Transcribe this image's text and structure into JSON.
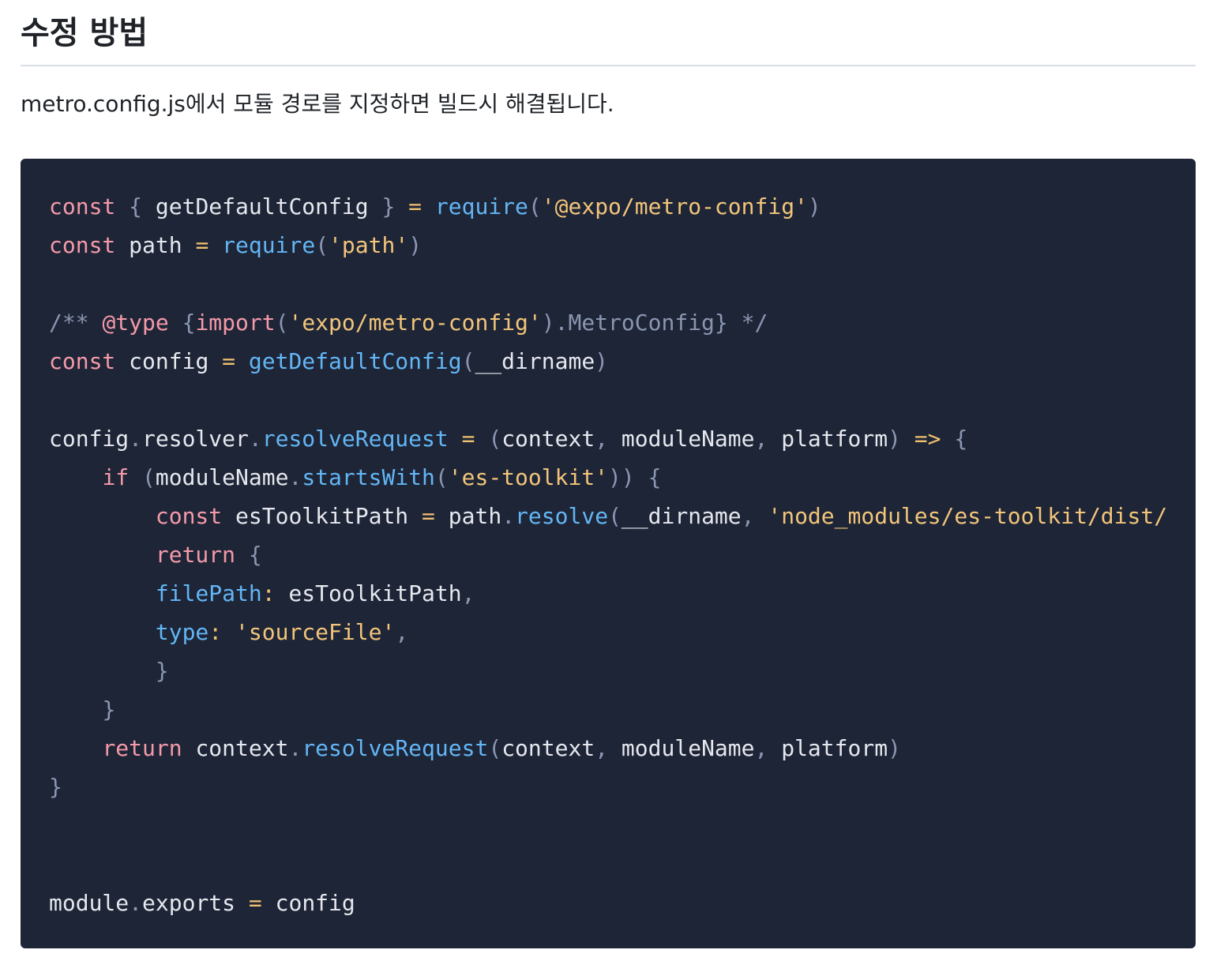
{
  "heading": "수정 방법",
  "paragraph": "metro.config.js에서 모듈 경로를 지정하면 빌드시 해결됩니다.",
  "code": {
    "language": "javascript",
    "lines": [
      [
        [
          "k",
          "const"
        ],
        [
          "id",
          " "
        ],
        [
          "p",
          "{"
        ],
        [
          "id",
          " getDefaultConfig "
        ],
        [
          "p",
          "}"
        ],
        [
          "id",
          " "
        ],
        [
          "o",
          "="
        ],
        [
          "id",
          " "
        ],
        [
          "f",
          "require"
        ],
        [
          "p",
          "("
        ],
        [
          "s",
          "'@expo/metro-config'"
        ],
        [
          "p",
          ")"
        ]
      ],
      [
        [
          "k",
          "const"
        ],
        [
          "id",
          " path "
        ],
        [
          "o",
          "="
        ],
        [
          "id",
          " "
        ],
        [
          "f",
          "require"
        ],
        [
          "p",
          "("
        ],
        [
          "s",
          "'path'"
        ],
        [
          "p",
          ")"
        ]
      ],
      [],
      [
        [
          "c",
          "/** "
        ],
        [
          "k",
          "@type"
        ],
        [
          "c",
          " "
        ],
        [
          "p",
          "{"
        ],
        [
          "k",
          "import"
        ],
        [
          "p",
          "("
        ],
        [
          "s",
          "'expo/metro-config'"
        ],
        [
          "p",
          ")."
        ],
        [
          "c",
          "MetroConfig"
        ],
        [
          "p",
          "}"
        ],
        [
          "c",
          " */"
        ]
      ],
      [
        [
          "k",
          "const"
        ],
        [
          "id",
          " config "
        ],
        [
          "o",
          "="
        ],
        [
          "id",
          " "
        ],
        [
          "f",
          "getDefaultConfig"
        ],
        [
          "p",
          "("
        ],
        [
          "id",
          "__dirname"
        ],
        [
          "p",
          ")"
        ]
      ],
      [],
      [
        [
          "id",
          "config"
        ],
        [
          "p",
          "."
        ],
        [
          "id",
          "resolver"
        ],
        [
          "p",
          "."
        ],
        [
          "f",
          "resolveRequest"
        ],
        [
          "id",
          " "
        ],
        [
          "o",
          "="
        ],
        [
          "id",
          " "
        ],
        [
          "p",
          "("
        ],
        [
          "id",
          "context"
        ],
        [
          "p",
          ","
        ],
        [
          "id",
          " moduleName"
        ],
        [
          "p",
          ","
        ],
        [
          "id",
          " platform"
        ],
        [
          "p",
          ")"
        ],
        [
          "id",
          " "
        ],
        [
          "o",
          "=>"
        ],
        [
          "id",
          " "
        ],
        [
          "p",
          "{"
        ]
      ],
      [
        [
          "id",
          "    "
        ],
        [
          "k",
          "if"
        ],
        [
          "id",
          " "
        ],
        [
          "p",
          "("
        ],
        [
          "id",
          "moduleName"
        ],
        [
          "p",
          "."
        ],
        [
          "f",
          "startsWith"
        ],
        [
          "p",
          "("
        ],
        [
          "s",
          "'es-toolkit'"
        ],
        [
          "p",
          "))"
        ],
        [
          "id",
          " "
        ],
        [
          "p",
          "{"
        ]
      ],
      [
        [
          "id",
          "        "
        ],
        [
          "k",
          "const"
        ],
        [
          "id",
          " esToolkitPath "
        ],
        [
          "o",
          "="
        ],
        [
          "id",
          " path"
        ],
        [
          "p",
          "."
        ],
        [
          "f",
          "resolve"
        ],
        [
          "p",
          "("
        ],
        [
          "id",
          "__dirname"
        ],
        [
          "p",
          ","
        ],
        [
          "id",
          " "
        ],
        [
          "s",
          "'node_modules/es-toolkit/dist/"
        ]
      ],
      [
        [
          "id",
          "        "
        ],
        [
          "k",
          "return"
        ],
        [
          "id",
          " "
        ],
        [
          "p",
          "{"
        ]
      ],
      [
        [
          "id",
          "        "
        ],
        [
          "f",
          "filePath"
        ],
        [
          "o",
          ":"
        ],
        [
          "id",
          " esToolkitPath"
        ],
        [
          "p",
          ","
        ]
      ],
      [
        [
          "id",
          "        "
        ],
        [
          "f",
          "type"
        ],
        [
          "o",
          ":"
        ],
        [
          "id",
          " "
        ],
        [
          "s",
          "'sourceFile'"
        ],
        [
          "p",
          ","
        ]
      ],
      [
        [
          "id",
          "        "
        ],
        [
          "p",
          "}"
        ]
      ],
      [
        [
          "id",
          "    "
        ],
        [
          "p",
          "}"
        ]
      ],
      [
        [
          "id",
          "    "
        ],
        [
          "k",
          "return"
        ],
        [
          "id",
          " context"
        ],
        [
          "p",
          "."
        ],
        [
          "f",
          "resolveRequest"
        ],
        [
          "p",
          "("
        ],
        [
          "id",
          "context"
        ],
        [
          "p",
          ","
        ],
        [
          "id",
          " moduleName"
        ],
        [
          "p",
          ","
        ],
        [
          "id",
          " platform"
        ],
        [
          "p",
          ")"
        ]
      ],
      [
        [
          "p",
          "}"
        ]
      ],
      [],
      [],
      [
        [
          "id",
          "module"
        ],
        [
          "p",
          "."
        ],
        [
          "id",
          "exports"
        ],
        [
          "id",
          " "
        ],
        [
          "o",
          "="
        ],
        [
          "id",
          " config"
        ]
      ]
    ]
  }
}
